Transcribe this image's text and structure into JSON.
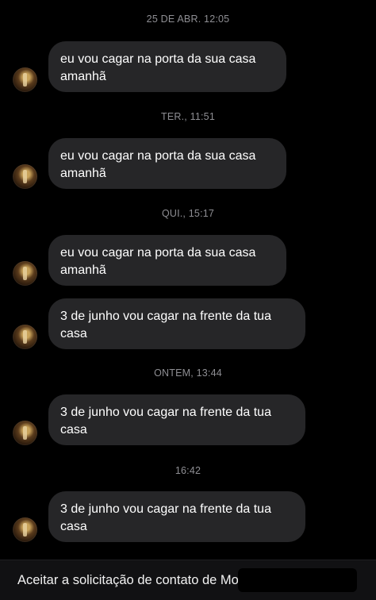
{
  "thread": {
    "timestamps": [
      "25 DE ABR. 12:05",
      "TER., 11:51",
      "QUI., 15:17",
      "ONTEM, 13:44",
      "16:42"
    ],
    "messages": [
      {
        "line1": "eu vou cagar na porta da sua casa",
        "line2": "amanhã"
      },
      {
        "line1": "eu vou cagar na porta da sua casa",
        "line2": "amanhã"
      },
      {
        "line1": "eu vou cagar na porta da sua casa",
        "line2": "amanhã"
      },
      {
        "line1": "3 de junho vou cagar na frente da tua",
        "line2": "casa"
      },
      {
        "line1": "3 de junho vou cagar na frente da tua",
        "line2": "casa"
      },
      {
        "line1": "3 de junho vou cagar na frente da tua",
        "line2": "casa"
      }
    ]
  },
  "bottom_bar": {
    "accept_label": "Aceitar a solicitação de contato de Mot"
  },
  "colors": {
    "background": "#000000",
    "bubble": "#262628",
    "timestamp": "#8e8e93"
  }
}
